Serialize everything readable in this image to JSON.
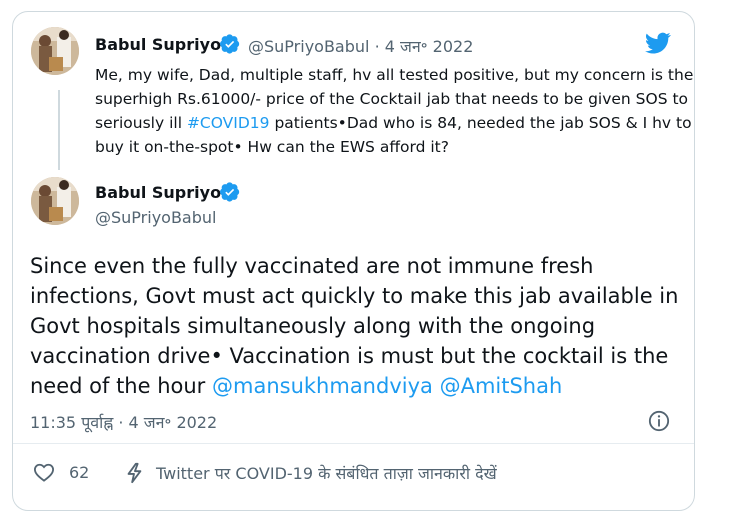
{
  "quoted_tweet": {
    "author_name": "Babul Supriyo",
    "handle": "@SuPriyoBabul",
    "date": "· 4 जन॰ 2022",
    "text_before": "Me, my wife, Dad, multiple staff, hv all tested positive, but my concern is the superhigh Rs.61000/- price of the Cocktail jab that needs to be given SOS to seriously ill ",
    "hashtag": "#COVID19",
    "text_after": " patients•Dad who is 84, needed the jab SOS & I hv to buy it on-the-spot• Hw can the EWS afford it?"
  },
  "main_tweet": {
    "author_name": "Babul Supriyo",
    "handle": "@SuPriyoBabul",
    "text": "Since even the fully vaccinated are not immune fresh infections, Govt must act quickly to make this jab available in Govt hospitals simultaneously along with the ongoing vaccination drive• Vaccination is must but the cocktail is the need of the hour ",
    "mention_1": "@mansukhmandviya",
    "mention_2": "@AmitShah",
    "timestamp": "11:35 पूर्वाह्न · 4 जन॰ 2022"
  },
  "actions": {
    "like_count": "62",
    "covid_info_label": "Twitter पर COVID-19 के संबंधित ताज़ा जानकारी देखें"
  },
  "icons": {
    "brand": "twitter-bird-icon",
    "verified": "verified-badge-icon",
    "info": "info-icon",
    "like": "heart-icon",
    "covid": "lightning-icon"
  },
  "colors": {
    "accent": "#1d9bf0",
    "secondary_text": "#536471",
    "border": "#cfd9de"
  }
}
